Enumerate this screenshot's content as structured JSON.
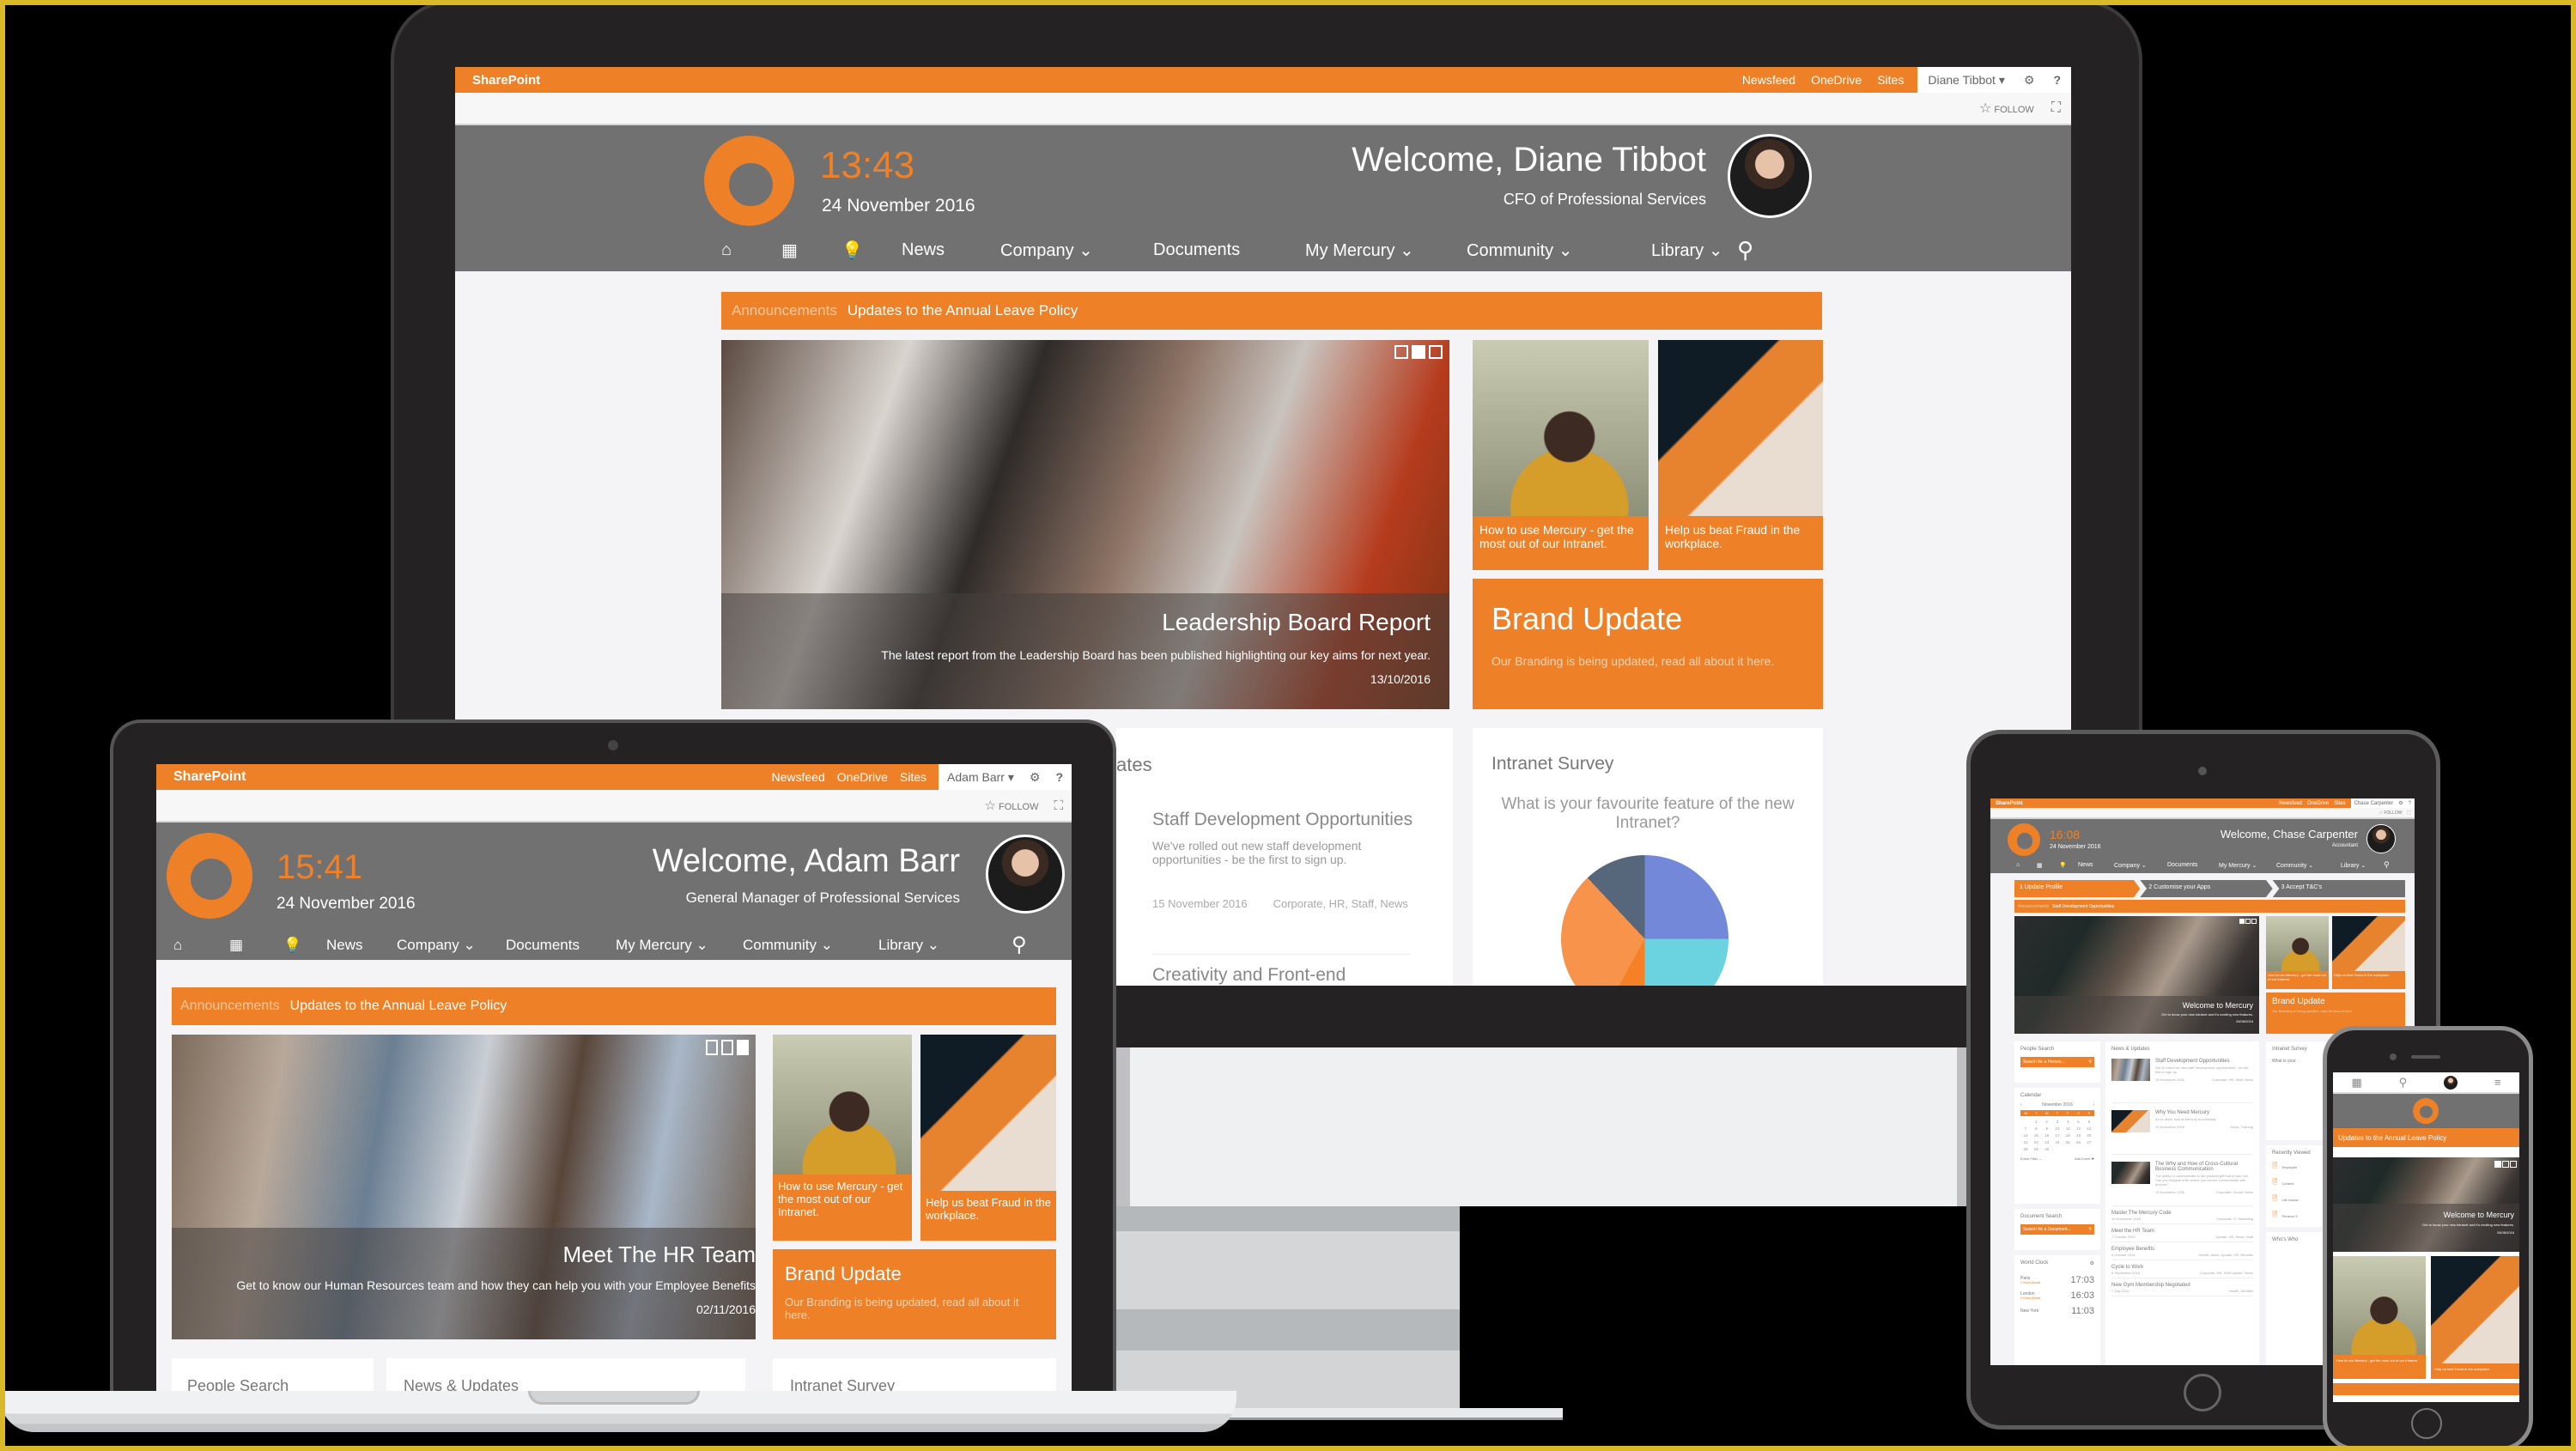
{
  "brand": {
    "orange": "#ee8128",
    "gray": "#717171",
    "suite_title": "SharePoint"
  },
  "suite_links": [
    "Newsfeed",
    "OneDrive",
    "Sites"
  ],
  "follow_label": "FOLLOW",
  "nav_items": [
    "News",
    "Company",
    "Documents",
    "My Mercury",
    "Community",
    "Library"
  ],
  "nav_icons": [
    "home-icon",
    "app-grid-icon",
    "lightbulb-icon",
    "search-icon"
  ],
  "announcement": {
    "label": "Announcements",
    "text": "Updates to the Annual Leave Policy"
  },
  "tiles": {
    "mercury": "How to use Mercury - get the most out of our Intranet.",
    "fraud": "Help us beat Fraud in the workplace.",
    "brand_title": "Brand Update",
    "brand_text": "Our Branding is being updated, read all about it here."
  },
  "monitor": {
    "user": "Diane Tibbot",
    "time": "13:43",
    "date": "24 November 2016",
    "welcome": "Welcome, Diane Tibbot",
    "role": "CFO of Professional Services",
    "hero": {
      "title": "Leadership Board Report",
      "text": "The latest report from the Leadership Board has been published highlighting our key aims for next year.",
      "date": "13/10/2016"
    },
    "news_heading_partial": "ates",
    "news": [
      {
        "title": "Staff Development Opportunities",
        "text": "We've rolled out new staff development opportunities - be the first to sign up.",
        "date": "15 November 2016",
        "tags": "Corporate, HR, Staff, News"
      },
      {
        "title": "Creativity and Front-end Development"
      }
    ],
    "survey": {
      "title": "Intranet Survey",
      "question": "What is your favourite feature of the new Intranet?"
    }
  },
  "laptop": {
    "user": "Adam Barr",
    "time": "15:41",
    "date": "24 November 2016",
    "welcome": "Welcome, Adam Barr",
    "role": "General Manager of Professional Services",
    "hero": {
      "title": "Meet The HR Team",
      "text": "Get to know our Human Resources team and how they can help you with your Employee Benefits",
      "date": "02/11/2016"
    },
    "cards": [
      "People Search",
      "News & Updates",
      "Intranet Survey"
    ]
  },
  "tablet": {
    "user": "Chase Carpenter",
    "time": "16:08",
    "date": "24 November 2016",
    "welcome": "Welcome, Chase Carpenter",
    "role": "Accountant",
    "steps": [
      "1  Update Profile",
      "2  Customise your Apps",
      "3  Accept T&C's"
    ],
    "announcement_text": "Staff Development Opportunities",
    "hero": {
      "title": "Welcome to Mercury",
      "text": "Get to know your new Intranet and it's exciting new features.",
      "date": "26/08/2016"
    },
    "people_search": {
      "title": "People Search",
      "placeholder": "Search for a Person..."
    },
    "calendar": {
      "title": "Calendar",
      "month": "November 2016",
      "weekdays": [
        "M",
        "T",
        "W",
        "T",
        "F",
        "S",
        "S"
      ],
      "days": [
        "",
        "1",
        "2",
        "3",
        "4",
        "5",
        "6",
        "7",
        "8",
        "9",
        "10",
        "11",
        "12",
        "13",
        "14",
        "15",
        "16",
        "17",
        "18",
        "19",
        "20",
        "21",
        "22",
        "23",
        "24",
        "25",
        "26",
        "27",
        "28",
        "29",
        "30"
      ],
      "event_filter": "Event Filter",
      "add_event": "Add Event"
    },
    "document_search": {
      "title": "Document Search",
      "placeholder": "Search for a Document..."
    },
    "world_clock": {
      "title": "World Clock",
      "cities": [
        {
          "name": "Paris",
          "offset": "1 Hours Ahead",
          "time": "17:03"
        },
        {
          "name": "London",
          "offset": "0 Hours Ahead",
          "time": "16:03"
        },
        {
          "name": "New York",
          "offset": "",
          "time": "11:03"
        }
      ]
    },
    "news": {
      "title": "News & Updates",
      "featured": [
        {
          "title": "Staff Development Opportunities",
          "text": "We've rolled out new staff development opportunities - be the first to sign up.",
          "date": "15 November 2016",
          "tags": "Corporate, HR, Staff, News"
        },
        {
          "title": "Why You Need Mercury",
          "text": "An in-depth look at Mercury functionality",
          "date": "14 November 2016",
          "tags": "News, Training"
        },
        {
          "title": "The Why and How of Cross-Cultural Business Communication",
          "text": "The ability to communicate is the greatest gift that a man has. Can you imagine a life where you cannot communicate with anyone?",
          "date": "13 November 2016",
          "tags": "Corporate, Social, News"
        }
      ],
      "list": [
        {
          "title": "Master The Mercury Code",
          "date": "10 November 2016",
          "tags": "Corporate, IT, Marketing"
        },
        {
          "title": "Meet the HR Team",
          "date": "7 October 2016",
          "tags": "Update, HR, News, Staff"
        },
        {
          "title": "Employee Benefits",
          "date": "3 October 2016",
          "tags": "Health, News, Update, HR, Benefits"
        },
        {
          "title": "Cycle to Work",
          "date": "8 September 2016",
          "tags": "Corporate, HR, Staff Update, News"
        },
        {
          "title": "New Gym Membership Negotiated",
          "date": "7 July 2016",
          "tags": "Health, Benefits"
        }
      ]
    },
    "survey_title": "Intranet Survey",
    "survey_question": "What is your",
    "recently_viewed": {
      "title": "Recently Viewed",
      "items": [
        "Employee",
        "Content",
        "Life Insura",
        "Pension S"
      ]
    },
    "whos_who": "Who's Who"
  },
  "phone": {
    "announcement": "Updates to the Annual Leave Policy",
    "hero": {
      "title": "Welcome to Mercury",
      "text": "Get to know your new Intranet and it's exciting new features.",
      "date": "26/08/2016"
    },
    "tiles": [
      "How to use Mercury - get the most out of our Intranet.",
      "Help us beat Fraud in the workplace."
    ]
  }
}
